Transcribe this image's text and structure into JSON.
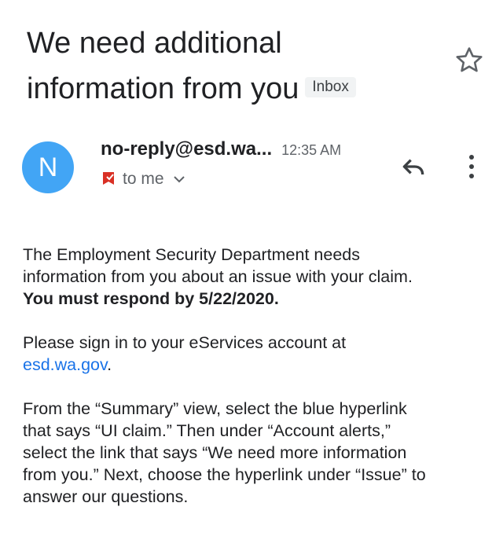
{
  "email": {
    "subject_line1": "We need additional",
    "subject_line2": "information from you",
    "label": "Inbox",
    "sender_initial": "N",
    "sender": "no-reply@esd.wa...",
    "time": "12:35 AM",
    "recipient": "to me"
  },
  "body": {
    "p1_line1": "The Employment Security Department needs",
    "p1_line2": "information from you about an issue with your claim.",
    "p1_bold": "You must respond by 5/22/2020.",
    "p2_text": "Please sign in to your eServices account at",
    "p2_link": "esd.wa.gov",
    "p2_after": ".",
    "p3_line1": "From the “Summary” view, select the blue hyperlink",
    "p3_line2": "that says “UI claim.” Then under “Account alerts,”",
    "p3_line3": "select the link that says “We need more information",
    "p3_line4": "from you.” Next, choose the hyperlink under “Issue” to",
    "p3_line5": "answer our questions."
  },
  "icons": {
    "star": "star-outline-icon",
    "reply": "reply-icon",
    "more": "more-vert-icon",
    "important": "label-important-icon",
    "expand": "chevron-down-icon"
  },
  "colors": {
    "avatar": "#42a5f5",
    "link": "#1a73e8",
    "important": "#d93025",
    "text": "#202124",
    "muted": "#5f6368"
  }
}
